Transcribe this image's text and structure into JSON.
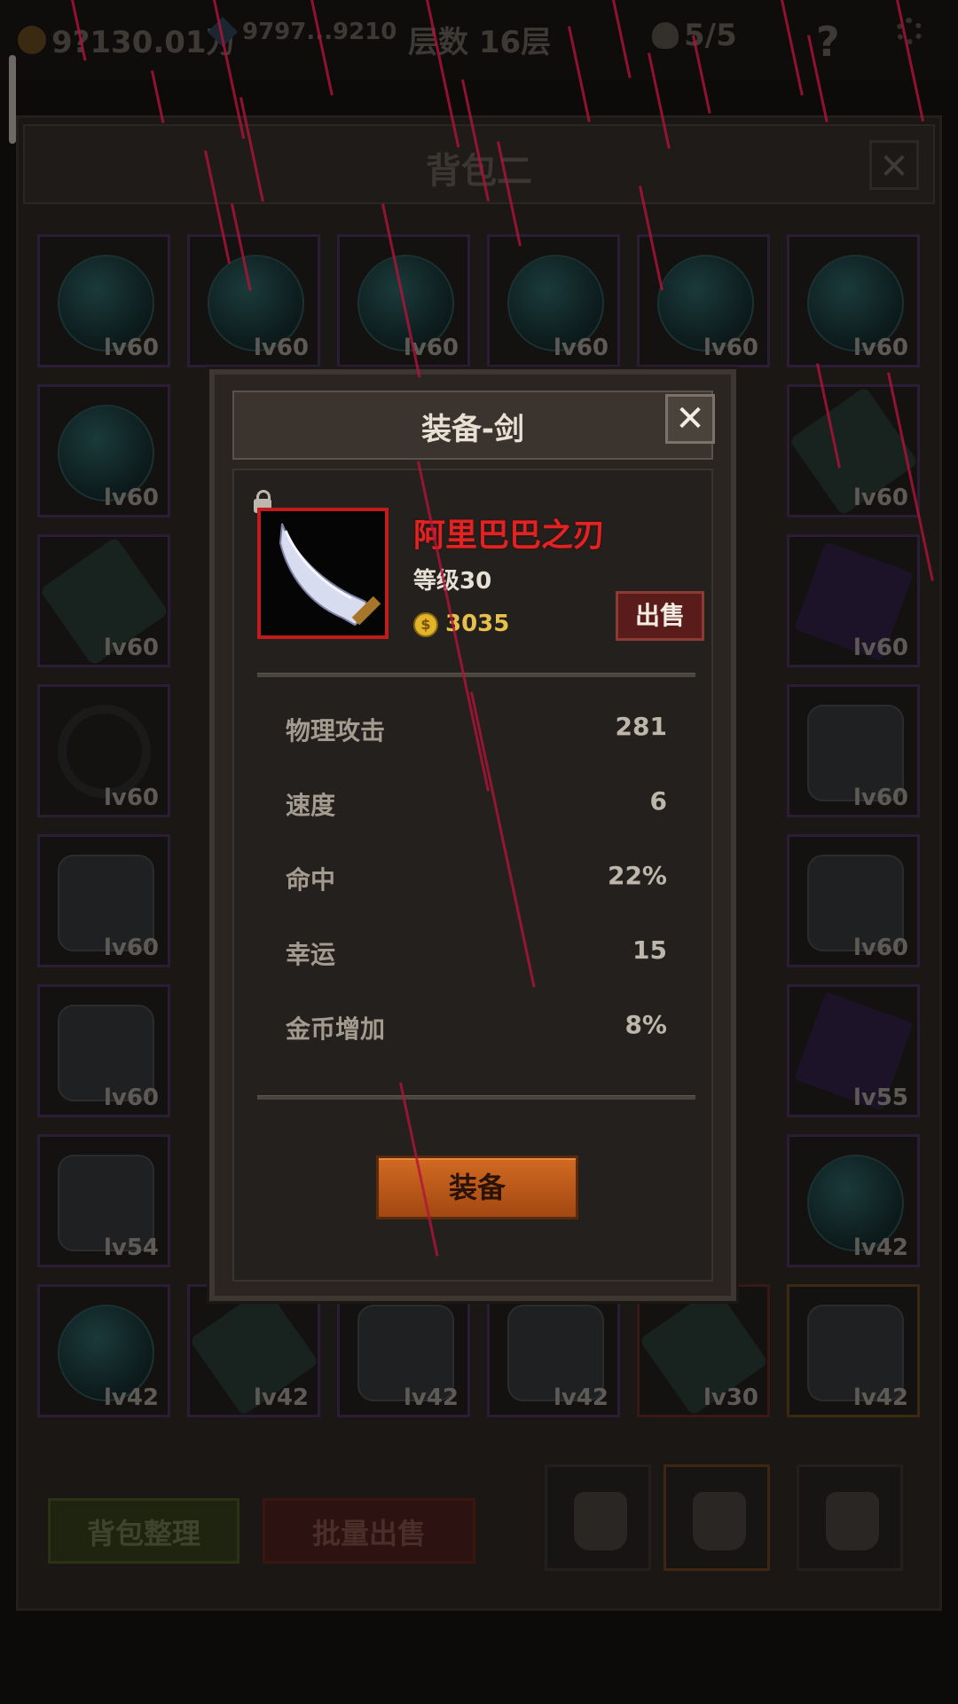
{
  "topbar": {
    "gold": "9?130.01万",
    "gems": "9797...9210",
    "floor": "层数 16层",
    "lives": "5/5",
    "help": "?"
  },
  "bag": {
    "title": "背包二",
    "close": "✕",
    "slots": [
      {
        "art": "orb",
        "lv": "lv60",
        "frame": "purple"
      },
      {
        "art": "orb",
        "lv": "lv60",
        "frame": "purple"
      },
      {
        "art": "orb",
        "lv": "lv60",
        "frame": "purple"
      },
      {
        "art": "orb",
        "lv": "lv60",
        "frame": "purple"
      },
      {
        "art": "orb",
        "lv": "lv60",
        "frame": "purple"
      },
      {
        "art": "orb",
        "lv": "lv60",
        "frame": "purple"
      },
      {
        "art": "orb",
        "lv": "lv60",
        "frame": "purple"
      },
      {
        "art": "blade",
        "lv": "lv60",
        "frame": "purple"
      },
      {
        "art": "blade",
        "lv": "lv60",
        "frame": "purple"
      },
      {
        "art": "gem",
        "lv": "lv60",
        "frame": "purple"
      },
      {
        "art": "ring",
        "lv": "lv60",
        "frame": "purple"
      },
      {
        "art": "armor",
        "lv": "lv60",
        "frame": "purple"
      },
      {
        "art": "armor",
        "lv": "lv60",
        "frame": "purple"
      },
      {
        "art": "armor",
        "lv": "lv60",
        "frame": "purple"
      },
      {
        "art": "armor",
        "lv": "lv60",
        "frame": "purple"
      },
      {
        "art": "gem",
        "lv": "lv55",
        "frame": "purple"
      },
      {
        "art": "armor",
        "lv": "lv54",
        "frame": "purple"
      },
      {
        "art": "orb",
        "lv": "lv42",
        "frame": "purple"
      },
      {
        "art": "orb",
        "lv": "lv42",
        "frame": "purple"
      },
      {
        "art": "blade",
        "lv": "lv42",
        "frame": "purple"
      },
      {
        "art": "armor",
        "lv": "lv42",
        "frame": "purple"
      },
      {
        "art": "armor",
        "lv": "lv42",
        "frame": "purple"
      },
      {
        "art": "blade",
        "lv": "lv30",
        "frame": "red"
      },
      {
        "art": "armor",
        "lv": "lv42",
        "frame": "orange"
      }
    ],
    "btn_sort": "背包整理",
    "btn_bulk_sell": "批量出售"
  },
  "modal": {
    "title": "装备-剑",
    "close": "✕",
    "item_name": "阿里巴巴之刃",
    "item_level": "等级30",
    "price": "3035",
    "sell": "出售",
    "stats": [
      {
        "label": "物理攻击",
        "value": "281"
      },
      {
        "label": "速度",
        "value": "6"
      },
      {
        "label": "命中",
        "value": "22%"
      },
      {
        "label": "幸运",
        "value": "15"
      },
      {
        "label": "金币增加",
        "value": "8%"
      }
    ],
    "equip": "装备"
  },
  "colors": {
    "item_name": "#e02424",
    "rain": "#b2143a",
    "equip_button": "#c05a1a",
    "sell_button": "#5a1c1a"
  }
}
